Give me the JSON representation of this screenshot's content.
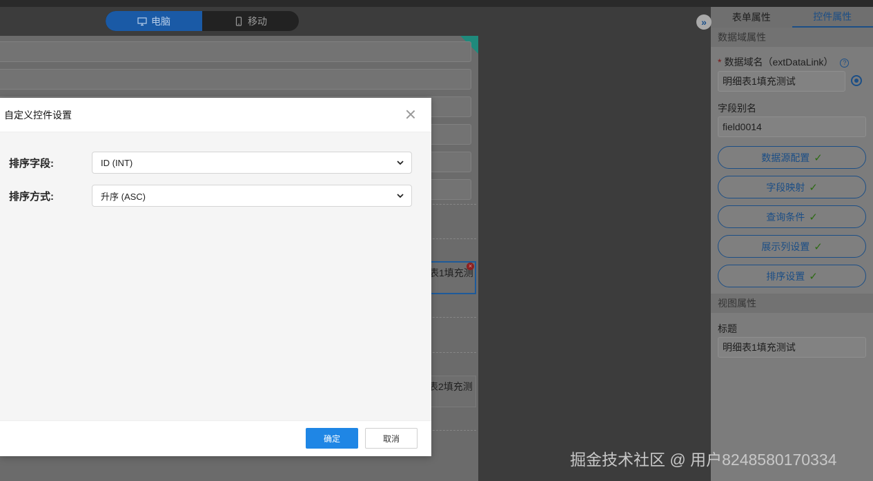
{
  "device_toggle": {
    "desktop_label": "电脑",
    "mobile_label": "移动",
    "active": "desktop"
  },
  "canvas": {
    "cell_1_text": "表1填充测",
    "cell_2_text": "表2填充测",
    "delete_glyph": "×"
  },
  "modal": {
    "title": "自定义控件设置",
    "sort_field_label": "排序字段:",
    "sort_field_value": "ID (INT)",
    "sort_order_label": "排序方式:",
    "sort_order_value": "升序 (ASC)",
    "ok_label": "确定",
    "cancel_label": "取消"
  },
  "panel": {
    "collapse_glyph": "»",
    "tabs": [
      "表单属性",
      "控件属性"
    ],
    "active_tab": 1,
    "data_section": "数据域属性",
    "data_name_label": "数据域名（extDataLink）",
    "data_name_value": "明细表1填充测试",
    "alias_label": "字段别名",
    "alias_value": "field0014",
    "buttons": [
      "数据源配置",
      "字段映射",
      "查询条件",
      "展示列设置",
      "排序设置"
    ],
    "check_glyph": "✓",
    "help_glyph": "?",
    "required_mark": "*",
    "view_section": "视图属性",
    "title_label": "标题",
    "title_value": "明细表1填充测试"
  },
  "watermark": "掘金技术社区 @ 用户8248580170334"
}
